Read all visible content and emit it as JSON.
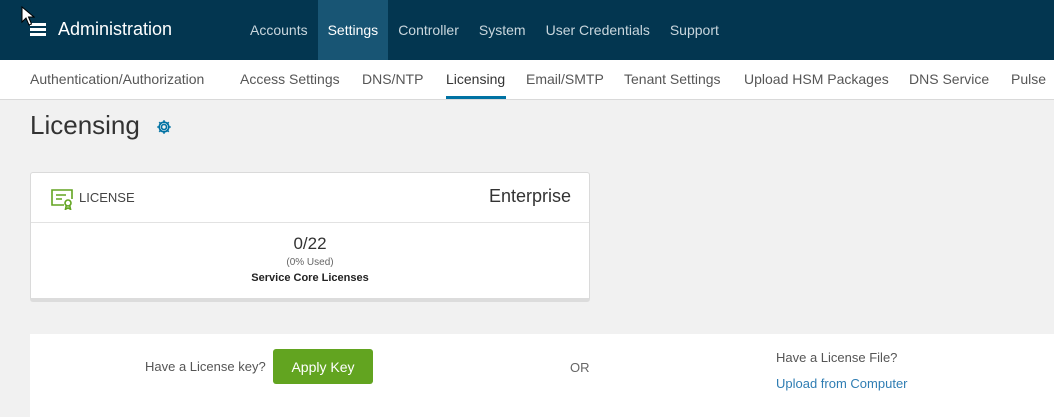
{
  "header": {
    "title": "Administration",
    "menu_icon": "hamburger-icon",
    "nav": [
      "Accounts",
      "Settings",
      "Controller",
      "System",
      "User Credentials",
      "Support"
    ],
    "active_nav": "Settings"
  },
  "subnav": {
    "items": [
      "Authentication/Authorization",
      "Access Settings",
      "DNS/NTP",
      "Licensing",
      "Email/SMTP",
      "Tenant Settings",
      "Upload HSM Packages",
      "DNS Service",
      "Pulse"
    ],
    "active": "Licensing"
  },
  "page": {
    "title": "Licensing",
    "settings_icon": "gear-icon"
  },
  "license_card": {
    "icon": "license-certificate-icon",
    "label": "LICENSE",
    "plan": "Enterprise",
    "count": "0/22",
    "used": "(0% Used)",
    "caption": "Service Core Licenses"
  },
  "apply": {
    "key_prompt": "Have a License key?",
    "button_label": "Apply Key",
    "or_label": "OR",
    "file_prompt": "Have a License File?",
    "upload_link": "Upload from Computer"
  },
  "colors": {
    "topbar": "#033650",
    "topnav_active": "#185574",
    "accent": "#0072a3",
    "button": "#62a420",
    "license_icon": "#62a420",
    "link": "#2f7db3"
  }
}
